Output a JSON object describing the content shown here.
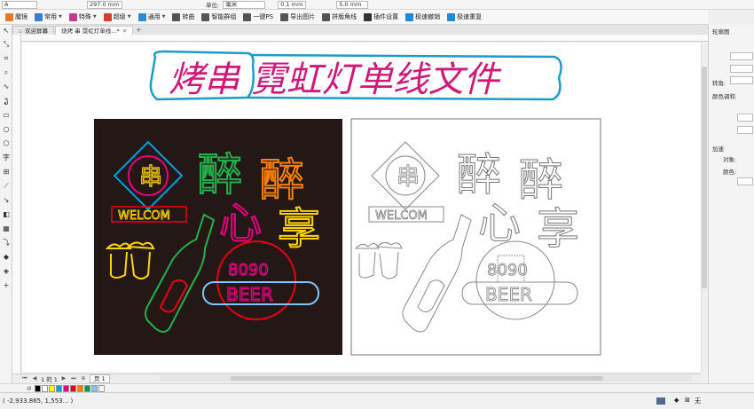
{
  "propbar": {
    "font_field": "A",
    "size_value": "297.0 mm",
    "unit_label": "单位:",
    "unit_value": "毫米",
    "nudge_value": "0.1 mm",
    "dup_value": "5.0 mm"
  },
  "plugin_toolbar": {
    "items": [
      {
        "label": "魔镜",
        "icon": "mirror-icon",
        "color": "#e8792a",
        "caret": false
      },
      {
        "label": "常用",
        "icon": "star-icon",
        "color": "#3a7bd5",
        "caret": true
      },
      {
        "label": "特殊",
        "icon": "special-icon",
        "color": "#c23b8c",
        "caret": true
      },
      {
        "label": "超级",
        "icon": "super-icon",
        "color": "#d23f2e",
        "caret": true
      },
      {
        "label": "通用",
        "icon": "general-icon",
        "color": "#2e8bd2",
        "caret": true
      },
      {
        "label": "转曲",
        "icon": "curve-icon",
        "color": "#555555",
        "caret": false
      },
      {
        "label": "智能群组",
        "icon": "group-icon",
        "color": "#555555",
        "caret": false
      },
      {
        "label": "一键PS",
        "icon": "ps-icon",
        "color": "#555555",
        "caret": false
      },
      {
        "label": "导出图片",
        "icon": "export-image-icon",
        "color": "#555555",
        "caret": false
      },
      {
        "label": "拼版角线",
        "icon": "crop-mark-icon",
        "color": "#555555",
        "caret": false
      },
      {
        "label": "插件设置",
        "icon": "settings-gear-icon",
        "color": "#333333",
        "caret": false
      },
      {
        "label": "极速撤销",
        "icon": "undo-icon",
        "color": "#1c8ad6",
        "caret": false
      },
      {
        "label": "极速重复",
        "icon": "redo-icon",
        "color": "#1c8ad6",
        "caret": false
      }
    ]
  },
  "tabs": [
    {
      "label": "欢迎屏幕",
      "active": false
    },
    {
      "label": "烧烤 串 霓虹灯单线...*",
      "active": true
    }
  ],
  "docker": {
    "title": "轮廓图",
    "corner_label": "转角:",
    "color_blend": "颜色调和",
    "accel": "加速",
    "object_label": "对象:",
    "color_label": "颜色:"
  },
  "canvas": {
    "title_text": "烤串 霓虹灯单线文件",
    "title_color": "#d0187a",
    "left_panel": {
      "welcom": "WELCOM",
      "zui1": "醉",
      "zui2": "醉",
      "xin": "心",
      "xiang": "享",
      "num": "8090",
      "beer": "BEER",
      "chuan": "串"
    },
    "right_panel": {
      "welcom": "WELCOM",
      "zui1": "醉",
      "zui2": "醉",
      "xin": "心",
      "xiang": "享",
      "num": "8090",
      "beer": "BEER",
      "chuan": "串"
    }
  },
  "pagebar": {
    "page_count": "1 的 1",
    "page_tab": "页 1"
  },
  "palette": [
    "#000000",
    "#ffffff",
    "#ffff00",
    "#00a0e0",
    "#e6007e",
    "#e60012",
    "#ff7f00",
    "#009944",
    "#7fc3ff",
    "#ffffff"
  ],
  "status": {
    "coords": "( -2,933.865, 1,553... )",
    "fill_none": "无"
  }
}
